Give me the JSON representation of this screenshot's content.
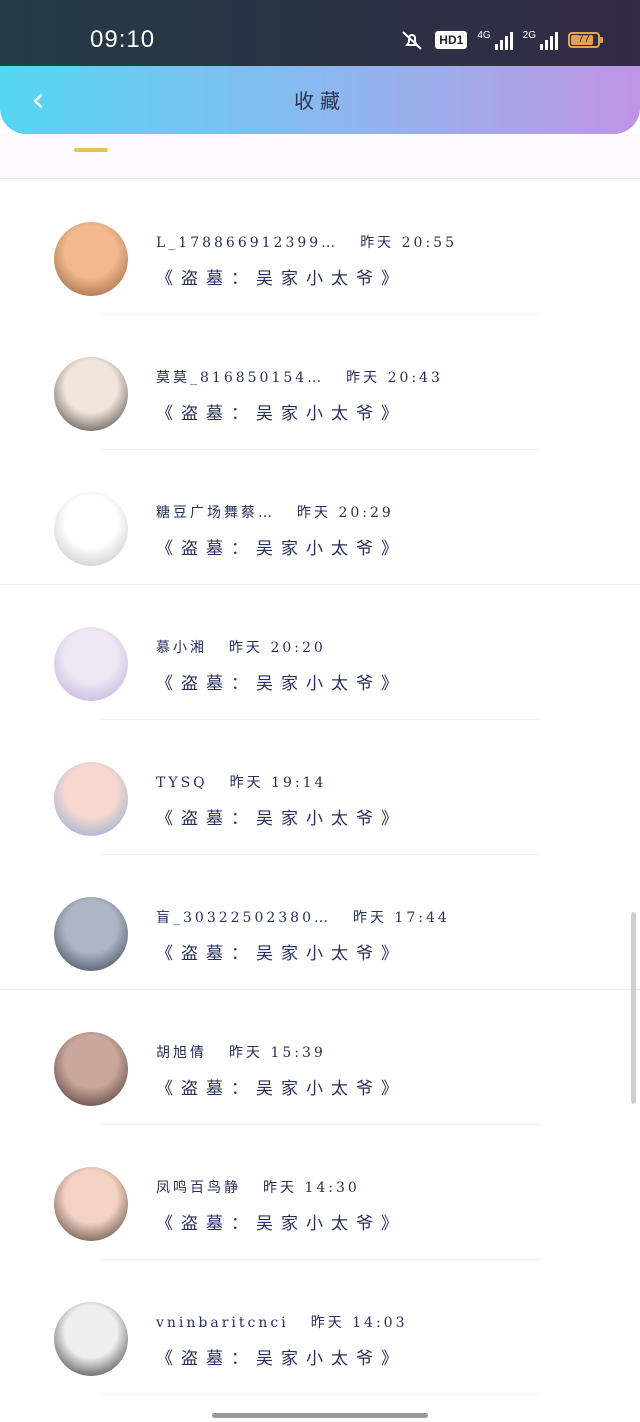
{
  "status_bar": {
    "time": "09:10",
    "hd": "HD1",
    "net1": "4G",
    "net2": "2G",
    "battery": "77"
  },
  "header": {
    "back_icon": "chevron-left-icon",
    "title": "收藏"
  },
  "items": [
    {
      "name": "L_17886691​2399…",
      "when": "昨天 20:55",
      "subtitle": "《盗墓：吴家小太爷》",
      "avatar_colors": [
        "#f2b98e",
        "#8a5638"
      ]
    },
    {
      "name": "莫莫_816850154…",
      "when": "昨天 20:43",
      "subtitle": "《盗墓：吴家小太爷》",
      "avatar_colors": [
        "#f1e6dc",
        "#2e2a2a"
      ]
    },
    {
      "name": "糖豆广场舞蔡…",
      "when": "昨天 20:29",
      "subtitle": "《盗墓：吴家小太爷》",
      "avatar_colors": [
        "#ffffff",
        "#b9b9bf"
      ]
    },
    {
      "name": "慕小湘",
      "when": "昨天 20:20",
      "subtitle": "《盗墓：吴家小太爷》",
      "avatar_colors": [
        "#efe6f4",
        "#b7a8d8"
      ]
    },
    {
      "name": "TYSQ",
      "when": "昨天 19:14",
      "subtitle": "《盗墓：吴家小太爷》",
      "avatar_colors": [
        "#f7d8cf",
        "#7aa5d6"
      ]
    },
    {
      "name": "盲_30322502380…",
      "when": "昨天 17:44",
      "subtitle": "《盗墓：吴家小太爷》",
      "avatar_colors": [
        "#aeb6c6",
        "#2f3442"
      ]
    },
    {
      "name": "胡旭倩",
      "when": "昨天 15:39",
      "subtitle": "《盗墓：吴家小太爷》",
      "avatar_colors": [
        "#caa79c",
        "#3b2626"
      ]
    },
    {
      "name": "凤鸣百鸟静",
      "when": "昨天 14:30",
      "subtitle": "《盗墓：吴家小太爷》",
      "avatar_colors": [
        "#f4d3c4",
        "#3a2a22"
      ]
    },
    {
      "name": "vninbaritcnci",
      "when": "昨天 14:03",
      "subtitle": "《盗墓：吴家小太爷》",
      "avatar_colors": [
        "#efefef",
        "#1b1b1b"
      ]
    }
  ]
}
